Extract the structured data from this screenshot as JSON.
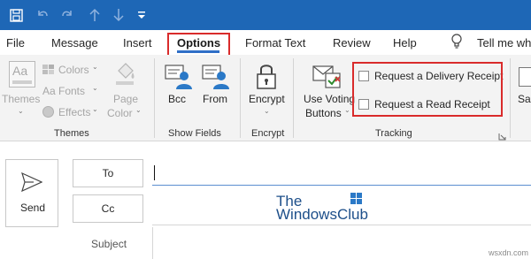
{
  "tabs": [
    "File",
    "Message",
    "Insert",
    "Options",
    "Format Text",
    "Review",
    "Help"
  ],
  "tell_me": "Tell me wh",
  "ribbon": {
    "themes": {
      "themes_label": "Themes",
      "colors_label": "Colors",
      "fonts_label": "Fonts",
      "effects_label": "Effects",
      "page_color_line1": "Page",
      "page_color_line2": "Color",
      "group_label": "Themes"
    },
    "show_fields": {
      "bcc_label": "Bcc",
      "from_label": "From",
      "group_label": "Show Fields"
    },
    "encrypt": {
      "encrypt_label": "Encrypt",
      "group_label": "Encrypt"
    },
    "tracking": {
      "voting_line1": "Use Voting",
      "voting_line2": "Buttons",
      "delivery_receipt_label": "Request a Delivery Receipt",
      "read_receipt_label": "Request a Read Receipt",
      "group_label": "Tracking",
      "delivery_receipt_checked": false,
      "read_receipt_checked": false
    },
    "partial_label": "Sa"
  },
  "compose": {
    "send_label": "Send",
    "to_label": "To",
    "cc_label": "Cc",
    "subject_label": "Subject"
  },
  "watermark": {
    "line1": "The",
    "line2": "WindowsClub"
  },
  "corner_text": "wsxdn.com",
  "colors": {
    "titlebar": "#1e67b6",
    "highlight_box": "#d92b2b",
    "active_underline": "#2f6fc7",
    "ribbon_bg": "#f3f3f3"
  }
}
